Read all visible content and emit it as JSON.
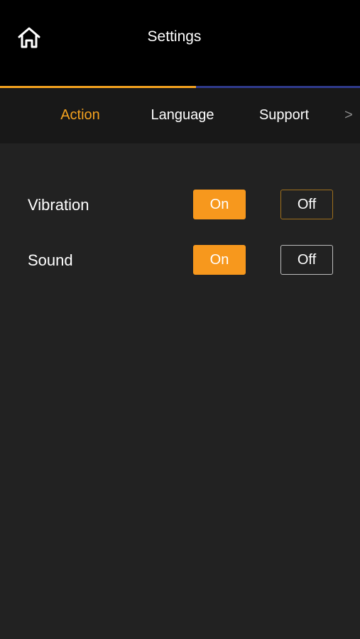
{
  "header": {
    "title": "Settings",
    "home_icon": "home-icon"
  },
  "progress": {
    "fraction": 0.545,
    "fill_color": "#f4a21f",
    "track_color": "#2f3a8c"
  },
  "tabs": [
    {
      "label": "Action",
      "active": true
    },
    {
      "label": "Language",
      "active": false
    },
    {
      "label": "Support",
      "active": false
    }
  ],
  "tab_next_glyph": ">",
  "settings": [
    {
      "label": "Vibration",
      "on_label": "On",
      "off_label": "Off",
      "selected": "On"
    },
    {
      "label": "Sound",
      "on_label": "On",
      "off_label": "Off",
      "selected": "On"
    }
  ],
  "colors": {
    "accent": "#f7981d",
    "background": "#222222",
    "header": "#000000",
    "tabbar": "#181818"
  }
}
